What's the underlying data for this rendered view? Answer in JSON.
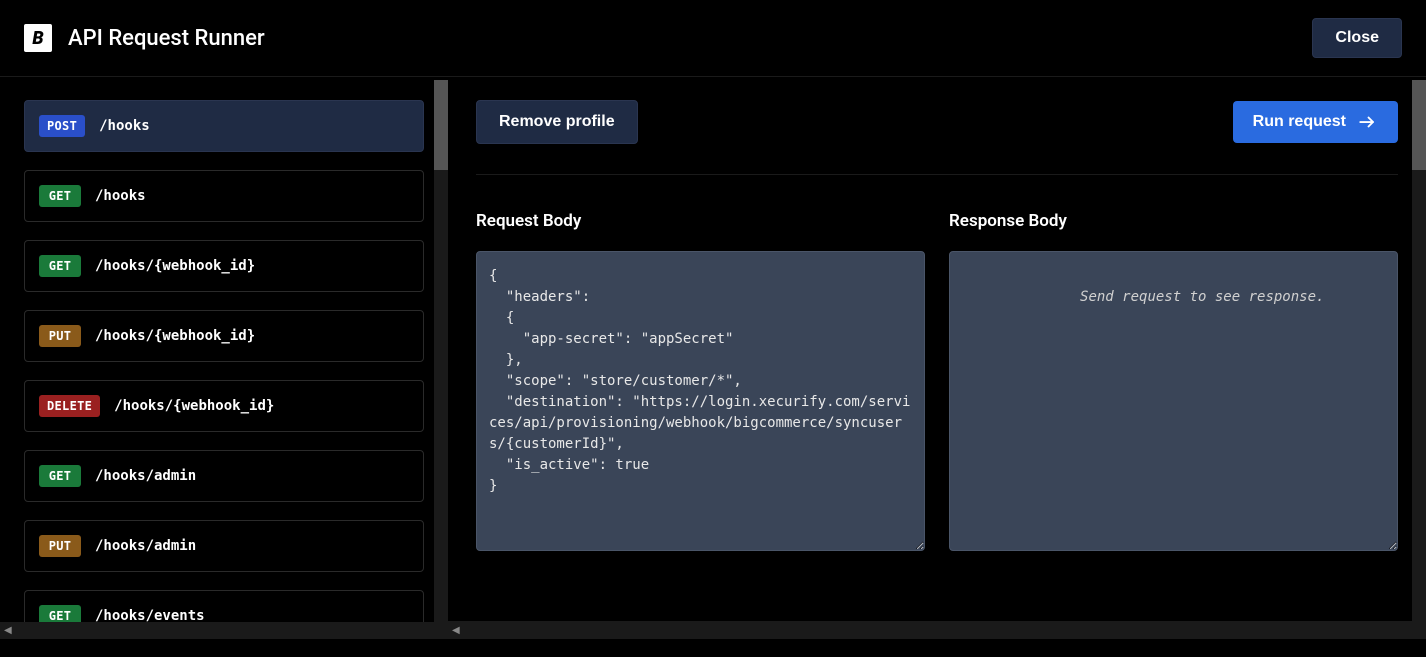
{
  "header": {
    "title": "API Request Runner",
    "close_label": "Close"
  },
  "sidebar": {
    "endpoints": [
      {
        "method": "POST",
        "path": "/hooks",
        "selected": true
      },
      {
        "method": "GET",
        "path": "/hooks",
        "selected": false
      },
      {
        "method": "GET",
        "path": "/hooks/{webhook_id}",
        "selected": false
      },
      {
        "method": "PUT",
        "path": "/hooks/{webhook_id}",
        "selected": false
      },
      {
        "method": "DELETE",
        "path": "/hooks/{webhook_id}",
        "selected": false
      },
      {
        "method": "GET",
        "path": "/hooks/admin",
        "selected": false
      },
      {
        "method": "PUT",
        "path": "/hooks/admin",
        "selected": false
      },
      {
        "method": "GET",
        "path": "/hooks/events",
        "selected": false
      }
    ]
  },
  "toolbar": {
    "remove_label": "Remove profile",
    "run_label": "Run request"
  },
  "panels": {
    "request_title": "Request Body",
    "response_title": "Response Body",
    "request_body": "{\n  \"headers\":\n  {\n    \"app-secret\": \"appSecret\"\n  },\n  \"scope\": \"store/customer/*\",\n  \"destination\": \"https://login.xecurify.com/services/api/provisioning/webhook/bigcommerce/syncusers/{customerId}\",\n  \"is_active\": true\n}",
    "response_placeholder": "Send request to see response."
  },
  "method_colors": {
    "POST": "method-post",
    "GET": "method-get",
    "PUT": "method-put",
    "DELETE": "method-delete"
  }
}
